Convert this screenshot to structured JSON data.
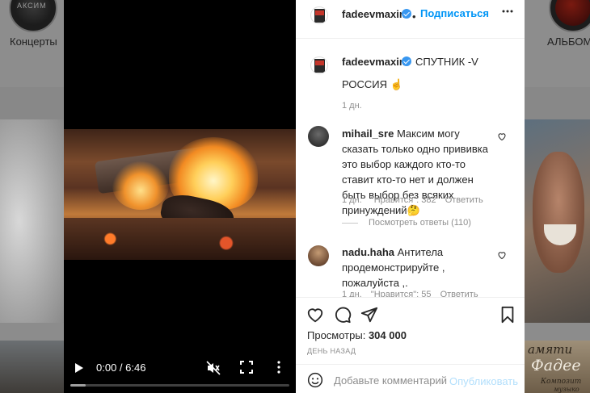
{
  "background": {
    "highlights": [
      {
        "label": "Концерты",
        "thumb_text": "АКСИМ"
      },
      {
        "label": "АЛЬБОМ"
      }
    ],
    "bottom_right_thumb": {
      "line1": "амяти",
      "line2": "Фадее",
      "line3": "Композит",
      "line4": "музыко"
    }
  },
  "video": {
    "time": "0:00 / 6:46",
    "progress": 0.07
  },
  "post": {
    "header": {
      "username": "fadeevmaxim",
      "separator": "•",
      "follow": "Подписаться",
      "close_icon": "close-icon"
    },
    "caption": {
      "username": "fadeevmaxim",
      "line1": "СПУТНИК -V",
      "line2": "РОССИЯ ☝",
      "age": "1 дн."
    },
    "comments": [
      {
        "username": "mihail_sre",
        "text": "Максим могу сказать только одно прививка это выбор каждого кто-то ставит кто-то нет и должен быть выбор без всяких принуждений🤔",
        "age": "1 дн.",
        "likes": "\"Нравится\": 382",
        "reply": "Ответить",
        "view_replies": "Посмотреть ответы (110)"
      },
      {
        "username": "nadu.haha",
        "text": "Антитела продемонстрируйте , пожалуйста ,.",
        "age": "1 дн.",
        "likes": "\"Нравится\": 55",
        "reply": "Ответить"
      }
    ],
    "views_label": "Просмотры:",
    "views_value": "304 000",
    "posted_ago": "ДЕНЬ НАЗАД",
    "comment_placeholder": "Добавьте комментарий...",
    "publish": "Опубликовать"
  },
  "colors": {
    "link": "#0095f6",
    "publish_disabled": "#b2dffc",
    "verified": "#3897f0"
  }
}
